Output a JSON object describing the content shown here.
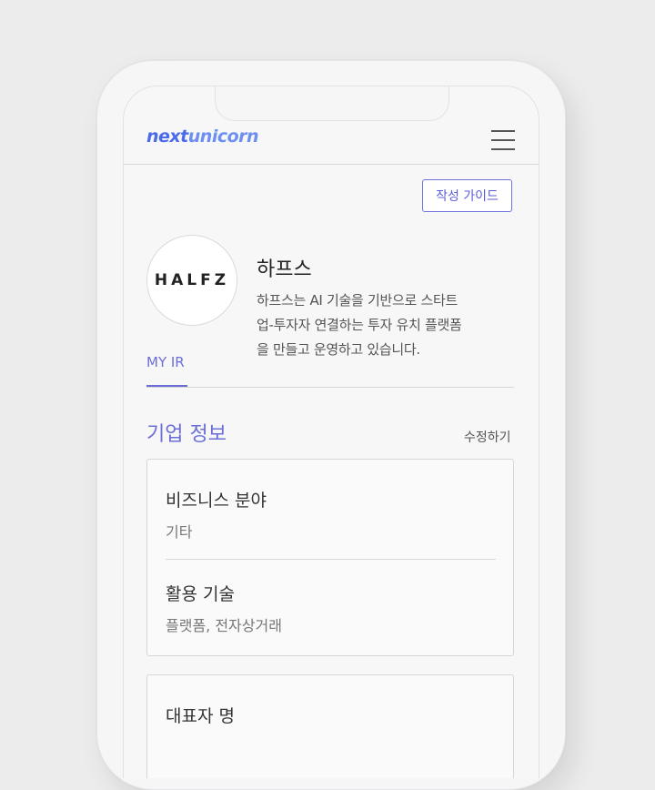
{
  "header": {
    "logo_part1": "next",
    "logo_part2": "unicorn"
  },
  "guide_button": "작성 가이드",
  "company": {
    "logo_text": "HALFZ",
    "name": "하프스",
    "desc_line1": "하프스는 AI 기술을 기반으로 스타트",
    "desc_line2": "업-투자자 연결하는 투자 유치 플랫폼",
    "desc_line3": "을 만들고 운영하고 있습니다."
  },
  "tabs": {
    "active": "MY IR"
  },
  "section": {
    "title": "기업 정보",
    "edit": "수정하기"
  },
  "fields": [
    {
      "label": "비즈니스 분야",
      "value": "기타"
    },
    {
      "label": "활용 기술",
      "value": "플랫폼, 전자상거래"
    },
    {
      "label": "대표자 명"
    }
  ],
  "colors": {
    "accent": "#6b6ed8",
    "logo_blue": "#4b6bea"
  }
}
